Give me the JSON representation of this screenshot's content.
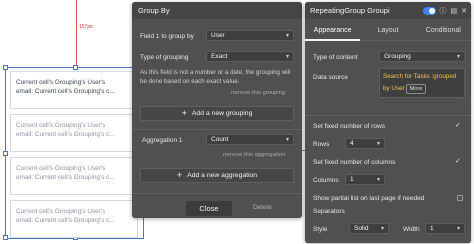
{
  "canvas": {
    "guide_label": "157px",
    "cells": [
      {
        "line1": "Current cell's Grouping's User's",
        "line2": "email: Current cell's Grouping's c..."
      },
      {
        "line1": "Current cell's Grouping's User's",
        "line2": "email: Current cell's Grouping's c..."
      },
      {
        "line1": "Current cell's Grouping's User's",
        "line2": "email: Current cell's Grouping's c..."
      },
      {
        "line1": "Current cell's Grouping's User's",
        "line2": "email: Current cell's Grouping's c..."
      }
    ]
  },
  "group_by": {
    "title": "Group By",
    "field_label": "Field 1 to group by",
    "field_value": "User",
    "type_label": "Type of grouping",
    "type_value": "Exact",
    "hint": "As this field is not a number or a date, the grouping will be done based on each exact value.",
    "remove_grouping": "remove this grouping",
    "add_grouping": "Add a new grouping",
    "aggregation_label": "Aggregation 1",
    "aggregation_value": "Count",
    "remove_aggregation": "remove this aggregation",
    "add_aggregation": "Add a new aggregation",
    "close": "Close",
    "delete": "Delete"
  },
  "editor": {
    "title": "RepeatingGroup Groupi",
    "tabs": [
      "Appearance",
      "Layout",
      "Conditional"
    ],
    "type_label": "Type of content",
    "type_value": "Grouping",
    "source_label": "Data source",
    "source_line1": "Search for Tasks :grouped",
    "source_line2": "by User",
    "source_more": "More",
    "fixed_rows_label": "Set fixed number of rows",
    "rows_label": "Rows",
    "rows_value": "4",
    "fixed_cols_label": "Set fixed number of columns",
    "cols_label": "Columns",
    "cols_value": "1",
    "partial_label": "Show partial list on last page if needed",
    "separators_label": "Separators",
    "style_label": "Style",
    "style_value": "Solid",
    "width_label": "Width",
    "width_value": "1"
  },
  "icons": {
    "check": "✓",
    "chevron": "▾",
    "plus": "+",
    "info": "ⓘ",
    "comment": "▤",
    "close": "✕"
  },
  "colors": {
    "panel": "#505050",
    "accent": "#3b82f6",
    "expression": "#f0c04a",
    "guide": "#e05757"
  }
}
